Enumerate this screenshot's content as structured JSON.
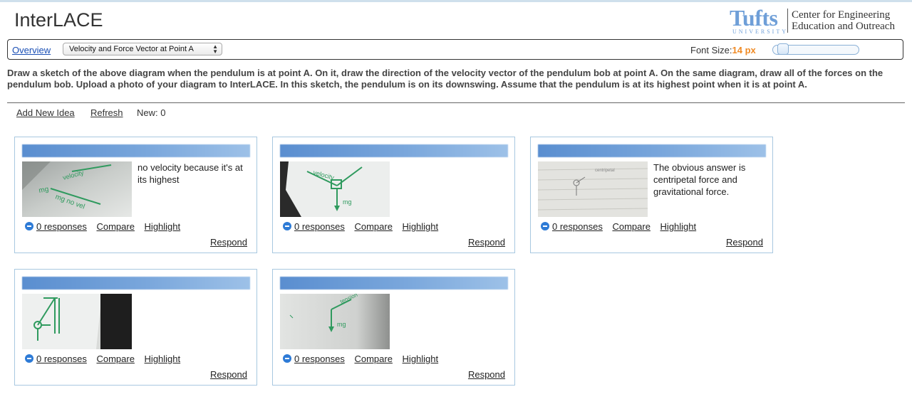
{
  "app": {
    "title": "InterLACE"
  },
  "brand": {
    "wordmark": "Tufts",
    "university": "UNIVERSITY",
    "center_line1": "Center for Engineering",
    "center_line2": "Education and Outreach",
    "color": "#6f9fd8"
  },
  "toolbar": {
    "overview_label": "Overview",
    "question_select": "Velocity and Force Vector at Point A",
    "font_size_label": "Font Size:",
    "font_size_value": "14 px",
    "font_size_color": "#f08a24"
  },
  "prompt": "Draw a sketch of the above diagram when the pendulum is at point A. On it, draw the direction of the velocity vector of the pendulum bob at point A. On the same diagram, draw all of the forces on the pendulum bob. Upload a photo of your diagram to InterLACE. In this sketch, the pendulum is on its downswing. Assume that the pendulum is at its highest point when it is at point A.",
  "actions": {
    "add_label": "Add New Idea",
    "refresh_label": "Refresh",
    "new_label": "New:",
    "new_count": "0"
  },
  "cards": [
    {
      "text": "no velocity because it's at its highest",
      "responses": "0 responses",
      "compare": "Compare",
      "highlight": "Highlight",
      "respond": "Respond"
    },
    {
      "text": "",
      "responses": "0 responses",
      "compare": "Compare",
      "highlight": "Highlight",
      "respond": "Respond"
    },
    {
      "text": "The obvious answer is centripetal force and gravitational force.",
      "responses": "0 responses",
      "compare": "Compare",
      "highlight": "Highlight",
      "respond": "Respond"
    },
    {
      "text": "",
      "responses": "0 responses",
      "compare": "Compare",
      "highlight": "Highlight",
      "respond": "Respond"
    },
    {
      "text": "",
      "responses": "0 responses",
      "compare": "Compare",
      "highlight": "Highlight",
      "respond": "Respond"
    }
  ]
}
